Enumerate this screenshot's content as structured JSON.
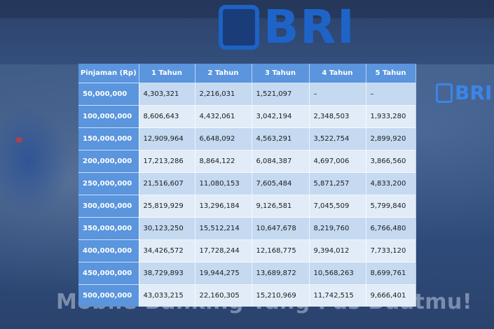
{
  "background": {
    "brand": "BRI",
    "tagline": "Mobile Banking Yang Pas Buatmu!",
    "colors": {
      "header_blue": "#5a95dd",
      "row_light": "#e2ecf8",
      "row_mid": "#c5d9f1",
      "brand_blue": "#1e64c8"
    }
  },
  "table": {
    "headers": [
      "Pinjaman (Rp)",
      "1 Tahun",
      "2 Tahun",
      "3 Tahun",
      "4 Tahun",
      "5 Tahun"
    ],
    "rows": [
      [
        "50,000,000",
        "4,303,321",
        "2,216,031",
        "1,521,097",
        "–",
        "–"
      ],
      [
        "100,000,000",
        "8,606,643",
        "4,432,061",
        "3,042,194",
        "2,348,503",
        "1,933,280"
      ],
      [
        "150,000,000",
        "12,909,964",
        "6,648,092",
        "4,563,291",
        "3,522,754",
        "2,899,920"
      ],
      [
        "200,000,000",
        "17,213,286",
        "8,864,122",
        "6,084,387",
        "4,697,006",
        "3,866,560"
      ],
      [
        "250,000,000",
        "21,516,607",
        "11,080,153",
        "7,605,484",
        "5,871,257",
        "4,833,200"
      ],
      [
        "300,000,000",
        "25,819,929",
        "13,296,184",
        "9,126,581",
        "7,045,509",
        "5,799,840"
      ],
      [
        "350,000,000",
        "30,123,250",
        "15,512,214",
        "10,647,678",
        "8,219,760",
        "6,766,480"
      ],
      [
        "400,000,000",
        "34,426,572",
        "17,728,244",
        "12,168,775",
        "9,394,012",
        "7,733,120"
      ],
      [
        "450,000,000",
        "38,729,893",
        "19,944,275",
        "13,689,872",
        "10,568,263",
        "8,699,761"
      ],
      [
        "500,000,000",
        "43,033,215",
        "22,160,305",
        "15,210,969",
        "11,742,515",
        "9,666,401"
      ]
    ]
  }
}
